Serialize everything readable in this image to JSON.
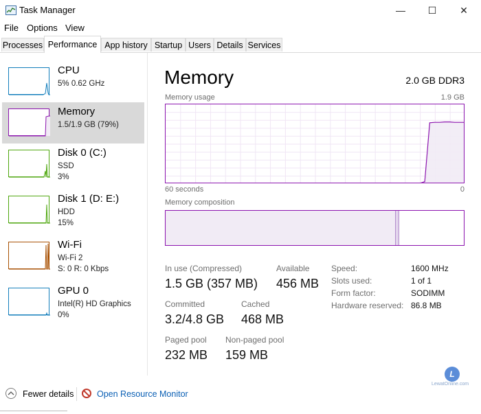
{
  "window": {
    "title": "Task Manager",
    "controls": {
      "minimize": "—",
      "maximize": "☐",
      "close": "✕"
    }
  },
  "menu": [
    "File",
    "Options",
    "View"
  ],
  "tabs": [
    "Processes",
    "Performance",
    "App history",
    "Startup",
    "Users",
    "Details",
    "Services"
  ],
  "active_tab": "Performance",
  "sidebar": [
    {
      "name": "CPU",
      "sub1": "5%  0.62 GHz",
      "sub2": "",
      "sub3": "",
      "color": "#117dbb",
      "selected": false
    },
    {
      "name": "Memory",
      "sub1": "1.5/1.9 GB (79%)",
      "sub2": "",
      "sub3": "",
      "color": "#8b12ae",
      "selected": true
    },
    {
      "name": "Disk 0 (C:)",
      "sub1": "SSD",
      "sub2": "3%",
      "sub3": "",
      "color": "#4da60c",
      "selected": false
    },
    {
      "name": "Disk 1 (D: E:)",
      "sub1": "HDD",
      "sub2": "15%",
      "sub3": "",
      "color": "#4da60c",
      "selected": false
    },
    {
      "name": "Wi-Fi",
      "sub1": "Wi-Fi 2",
      "sub2": "S: 0  R: 0 Kbps",
      "sub3": "",
      "color": "#a74f01",
      "selected": false
    },
    {
      "name": "GPU 0",
      "sub1": "Intel(R) HD Graphics",
      "sub2": "0%",
      "sub3": "",
      "color": "#117dbb",
      "selected": false
    }
  ],
  "main": {
    "title": "Memory",
    "spec": "2.0 GB DDR3",
    "usage_label": "Memory usage",
    "usage_max": "1.9 GB",
    "time_label": "60 seconds",
    "time_end": "0",
    "composition_label": "Memory composition",
    "accent": "#8b12ae"
  },
  "chart_data": {
    "type": "area",
    "title": "Memory usage",
    "xlabel": "60 seconds",
    "ylabel": "",
    "ylim": [
      0,
      1.9
    ],
    "x": [
      60,
      57,
      54,
      51,
      48,
      45,
      42,
      39,
      36,
      33,
      30,
      27,
      24,
      21,
      18,
      15,
      12,
      9,
      8,
      7,
      6,
      5,
      4,
      3,
      2,
      1,
      0
    ],
    "series": [
      {
        "name": "",
        "values": [
          0,
          0,
          0,
          0,
          0,
          0,
          0,
          0,
          0,
          0,
          0,
          0,
          0,
          0,
          0,
          0,
          0,
          0,
          0.04,
          1.47,
          1.48,
          1.48,
          1.49,
          1.49,
          1.48,
          1.48,
          1.48
        ]
      }
    ],
    "grid": true
  },
  "composition": {
    "in_use_fraction": 0.77,
    "modified_fraction": 0.01
  },
  "stats": {
    "in_use_label": "In use (Compressed)",
    "in_use": "1.5 GB (357 MB)",
    "available_label": "Available",
    "available": "456 MB",
    "committed_label": "Committed",
    "committed": "3.2/4.8 GB",
    "cached_label": "Cached",
    "cached": "468 MB",
    "paged_label": "Paged pool",
    "paged": "232 MB",
    "nonpaged_label": "Non-paged pool",
    "nonpaged": "159 MB"
  },
  "details": [
    {
      "label": "Speed:",
      "value": "1600 MHz"
    },
    {
      "label": "Slots used:",
      "value": "1 of 1"
    },
    {
      "label": "Form factor:",
      "value": "SODIMM"
    },
    {
      "label": "Hardware reserved:",
      "value": "86.8 MB"
    }
  ],
  "footer": {
    "fewer_details": "Fewer details",
    "resource_monitor": "Open Resource Monitor"
  },
  "watermark": {
    "logo_letter": "L",
    "text": "LewatOnline.com"
  }
}
